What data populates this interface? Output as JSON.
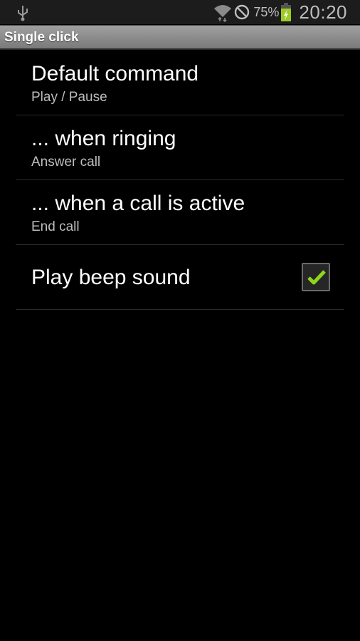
{
  "status_bar": {
    "left_icons": [
      "usb-icon"
    ],
    "right_icons": [
      "wifi-icon",
      "block-icon",
      "battery-charging-icon"
    ],
    "battery_percent": "75%",
    "time": "20:20",
    "battery_color": "#9ccc24"
  },
  "title_bar": {
    "title": "Single click"
  },
  "preferences": [
    {
      "title": "Default command",
      "summary": "Play / Pause"
    },
    {
      "title": "... when ringing",
      "summary": "Answer call"
    },
    {
      "title": "... when a call is active",
      "summary": "End call"
    },
    {
      "title": "Play beep sound",
      "checked": true
    }
  ],
  "colors": {
    "check_green": "#8fd61a"
  }
}
